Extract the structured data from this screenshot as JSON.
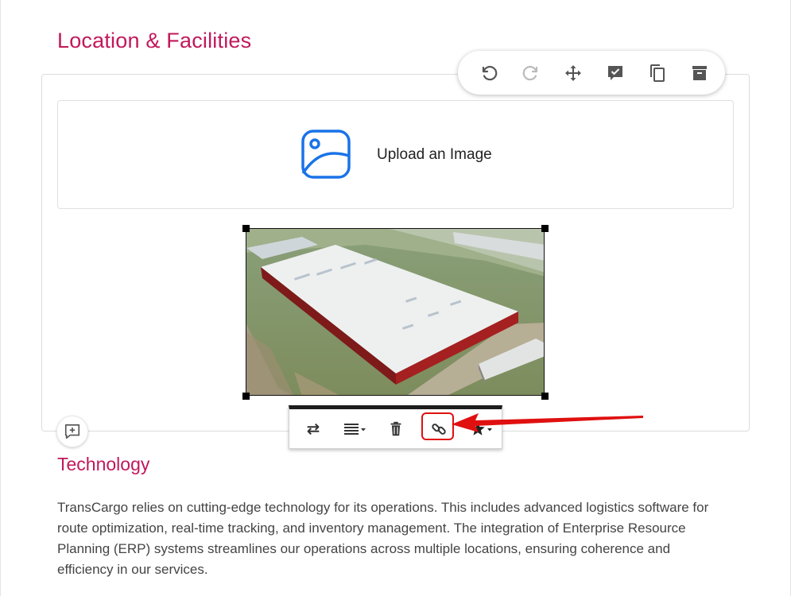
{
  "section": {
    "title": "Location & Facilities"
  },
  "block_toolbar": {
    "buttons": [
      {
        "icon": "undo-icon",
        "label": "Undo",
        "color": "#555555"
      },
      {
        "icon": "redo-icon",
        "label": "Redo",
        "color": "#bbbbbb"
      },
      {
        "icon": "move-icon",
        "label": "Move",
        "color": "#555555"
      },
      {
        "icon": "comment-check-icon",
        "label": "Review",
        "color": "#555555"
      },
      {
        "icon": "copy-icon",
        "label": "Duplicate",
        "color": "#555555"
      },
      {
        "icon": "archive-icon",
        "label": "Archive",
        "color": "#555555"
      }
    ]
  },
  "upload": {
    "label": "Upload an Image",
    "icon": "image-icon",
    "icon_color": "#1a73e8"
  },
  "image": {
    "subject": "aerial-warehouse-photo"
  },
  "image_toolbar": {
    "buttons": [
      {
        "icon": "swap-icon"
      },
      {
        "icon": "align-dropdown-icon"
      },
      {
        "icon": "trash-icon"
      },
      {
        "icon": "link-icon",
        "highlighted": true
      },
      {
        "icon": "star-dropdown-icon"
      }
    ]
  },
  "annotation": {
    "arrow_color": "#e01010"
  },
  "comment": {
    "icon": "add-comment-icon"
  },
  "technology": {
    "title": "Technology",
    "body": "TransCargo relies on cutting-edge technology for its operations. This includes advanced logistics software for route optimization, real-time tracking, and inventory management. The integration of Enterprise Resource Planning (ERP) systems streamlines our operations across multiple locations, ensuring coherence and efficiency in our services."
  },
  "theme": {
    "accent": "#c2185b",
    "text": "#444444"
  }
}
